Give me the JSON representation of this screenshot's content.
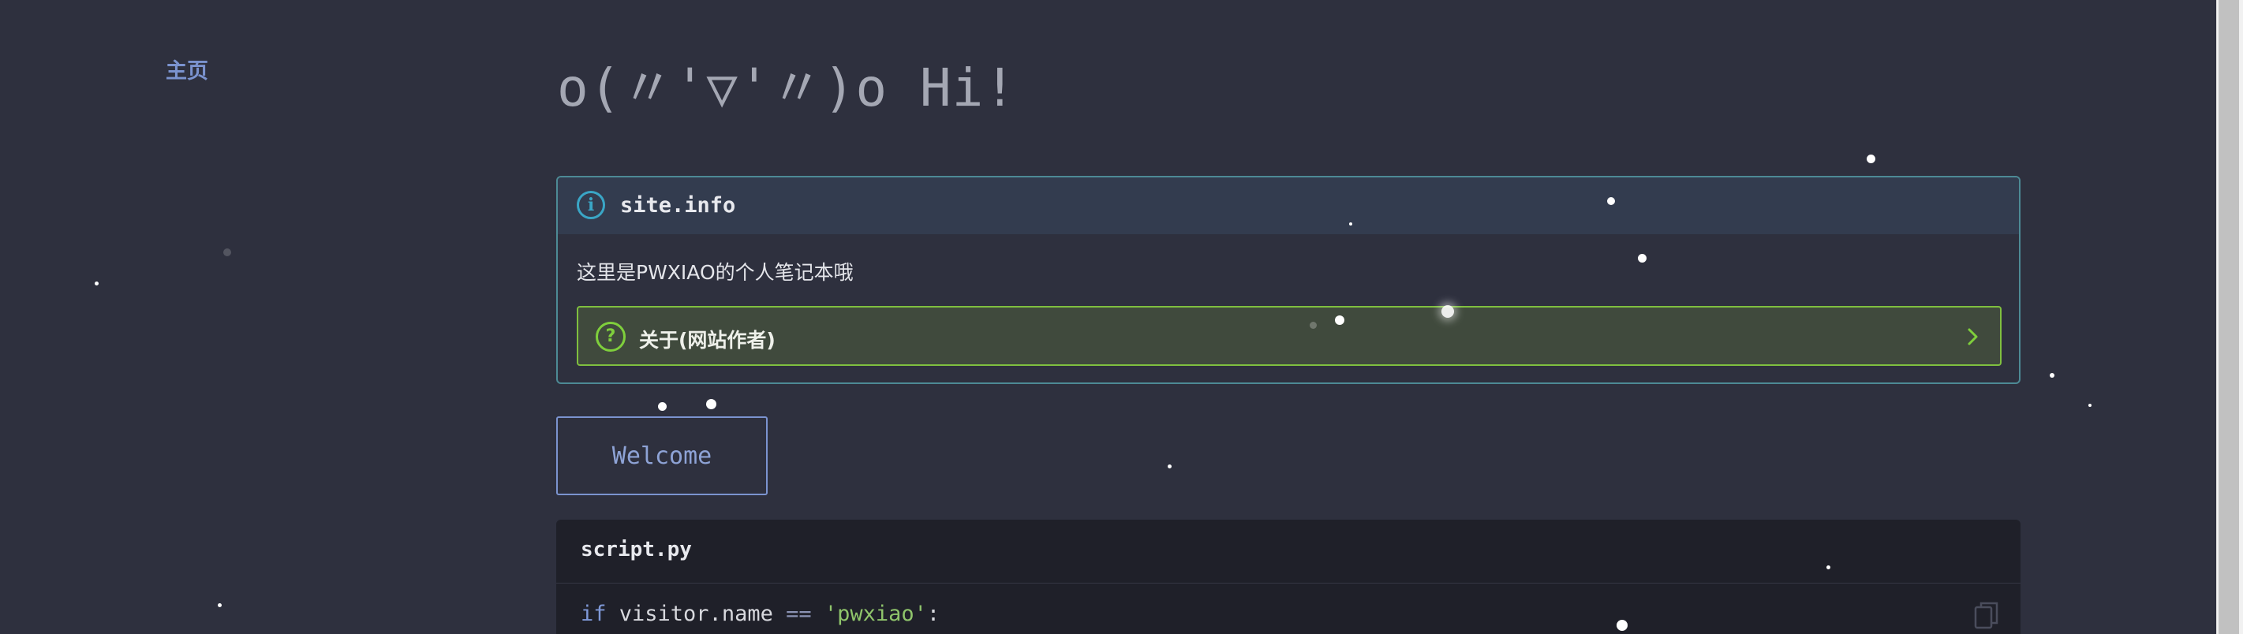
{
  "nav": {
    "home_label": "主页"
  },
  "page": {
    "title": "o(〃'▽'〃)o Hi!"
  },
  "info_admonition": {
    "icon": "info-icon",
    "title": "site.info",
    "body": "这里是PWXIAO的个人笔记本哦",
    "question": {
      "icon": "question-icon",
      "label": "关于(网站作者)",
      "chevron": "chevron-right-icon"
    }
  },
  "welcome_button": {
    "label": "Welcome"
  },
  "code_block": {
    "filename": "script.py",
    "line1": {
      "keyword": "if",
      "identifier": " visitor.name ",
      "operator": "==",
      "string": "'pwxiao'",
      "tail": ":"
    },
    "copy_icon": "copy-icon"
  },
  "colors": {
    "background": "#2e303e",
    "link": "#7b93cf",
    "info_accent": "#3aa6c6",
    "question_accent": "#7fcf3c",
    "code_bg": "#1f2029"
  }
}
